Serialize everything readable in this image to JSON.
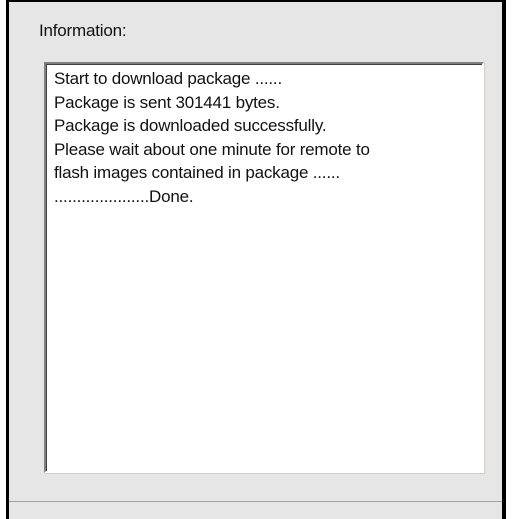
{
  "information": {
    "label": "Information:",
    "lines": [
      "Start to download package ......",
      "Package is sent 301441 bytes.",
      "Package is downloaded successfully.",
      "Please wait about one minute for remote to",
      "flash images contained in package ......",
      ".....................Done."
    ]
  }
}
